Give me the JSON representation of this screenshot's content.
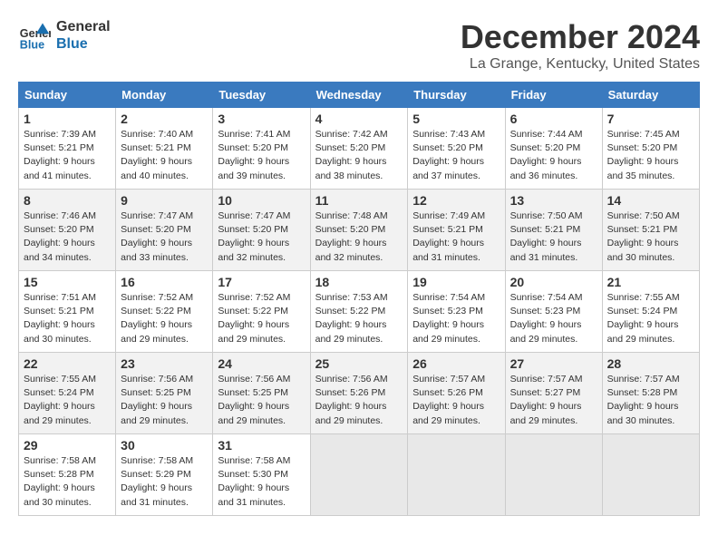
{
  "header": {
    "logo_line1": "General",
    "logo_line2": "Blue",
    "month": "December 2024",
    "location": "La Grange, Kentucky, United States"
  },
  "weekdays": [
    "Sunday",
    "Monday",
    "Tuesday",
    "Wednesday",
    "Thursday",
    "Friday",
    "Saturday"
  ],
  "weeks": [
    [
      {
        "day": "1",
        "sunrise": "Sunrise: 7:39 AM",
        "sunset": "Sunset: 5:21 PM",
        "daylight": "Daylight: 9 hours and 41 minutes."
      },
      {
        "day": "2",
        "sunrise": "Sunrise: 7:40 AM",
        "sunset": "Sunset: 5:21 PM",
        "daylight": "Daylight: 9 hours and 40 minutes."
      },
      {
        "day": "3",
        "sunrise": "Sunrise: 7:41 AM",
        "sunset": "Sunset: 5:20 PM",
        "daylight": "Daylight: 9 hours and 39 minutes."
      },
      {
        "day": "4",
        "sunrise": "Sunrise: 7:42 AM",
        "sunset": "Sunset: 5:20 PM",
        "daylight": "Daylight: 9 hours and 38 minutes."
      },
      {
        "day": "5",
        "sunrise": "Sunrise: 7:43 AM",
        "sunset": "Sunset: 5:20 PM",
        "daylight": "Daylight: 9 hours and 37 minutes."
      },
      {
        "day": "6",
        "sunrise": "Sunrise: 7:44 AM",
        "sunset": "Sunset: 5:20 PM",
        "daylight": "Daylight: 9 hours and 36 minutes."
      },
      {
        "day": "7",
        "sunrise": "Sunrise: 7:45 AM",
        "sunset": "Sunset: 5:20 PM",
        "daylight": "Daylight: 9 hours and 35 minutes."
      }
    ],
    [
      {
        "day": "8",
        "sunrise": "Sunrise: 7:46 AM",
        "sunset": "Sunset: 5:20 PM",
        "daylight": "Daylight: 9 hours and 34 minutes."
      },
      {
        "day": "9",
        "sunrise": "Sunrise: 7:47 AM",
        "sunset": "Sunset: 5:20 PM",
        "daylight": "Daylight: 9 hours and 33 minutes."
      },
      {
        "day": "10",
        "sunrise": "Sunrise: 7:47 AM",
        "sunset": "Sunset: 5:20 PM",
        "daylight": "Daylight: 9 hours and 32 minutes."
      },
      {
        "day": "11",
        "sunrise": "Sunrise: 7:48 AM",
        "sunset": "Sunset: 5:20 PM",
        "daylight": "Daylight: 9 hours and 32 minutes."
      },
      {
        "day": "12",
        "sunrise": "Sunrise: 7:49 AM",
        "sunset": "Sunset: 5:21 PM",
        "daylight": "Daylight: 9 hours and 31 minutes."
      },
      {
        "day": "13",
        "sunrise": "Sunrise: 7:50 AM",
        "sunset": "Sunset: 5:21 PM",
        "daylight": "Daylight: 9 hours and 31 minutes."
      },
      {
        "day": "14",
        "sunrise": "Sunrise: 7:50 AM",
        "sunset": "Sunset: 5:21 PM",
        "daylight": "Daylight: 9 hours and 30 minutes."
      }
    ],
    [
      {
        "day": "15",
        "sunrise": "Sunrise: 7:51 AM",
        "sunset": "Sunset: 5:21 PM",
        "daylight": "Daylight: 9 hours and 30 minutes."
      },
      {
        "day": "16",
        "sunrise": "Sunrise: 7:52 AM",
        "sunset": "Sunset: 5:22 PM",
        "daylight": "Daylight: 9 hours and 29 minutes."
      },
      {
        "day": "17",
        "sunrise": "Sunrise: 7:52 AM",
        "sunset": "Sunset: 5:22 PM",
        "daylight": "Daylight: 9 hours and 29 minutes."
      },
      {
        "day": "18",
        "sunrise": "Sunrise: 7:53 AM",
        "sunset": "Sunset: 5:22 PM",
        "daylight": "Daylight: 9 hours and 29 minutes."
      },
      {
        "day": "19",
        "sunrise": "Sunrise: 7:54 AM",
        "sunset": "Sunset: 5:23 PM",
        "daylight": "Daylight: 9 hours and 29 minutes."
      },
      {
        "day": "20",
        "sunrise": "Sunrise: 7:54 AM",
        "sunset": "Sunset: 5:23 PM",
        "daylight": "Daylight: 9 hours and 29 minutes."
      },
      {
        "day": "21",
        "sunrise": "Sunrise: 7:55 AM",
        "sunset": "Sunset: 5:24 PM",
        "daylight": "Daylight: 9 hours and 29 minutes."
      }
    ],
    [
      {
        "day": "22",
        "sunrise": "Sunrise: 7:55 AM",
        "sunset": "Sunset: 5:24 PM",
        "daylight": "Daylight: 9 hours and 29 minutes."
      },
      {
        "day": "23",
        "sunrise": "Sunrise: 7:56 AM",
        "sunset": "Sunset: 5:25 PM",
        "daylight": "Daylight: 9 hours and 29 minutes."
      },
      {
        "day": "24",
        "sunrise": "Sunrise: 7:56 AM",
        "sunset": "Sunset: 5:25 PM",
        "daylight": "Daylight: 9 hours and 29 minutes."
      },
      {
        "day": "25",
        "sunrise": "Sunrise: 7:56 AM",
        "sunset": "Sunset: 5:26 PM",
        "daylight": "Daylight: 9 hours and 29 minutes."
      },
      {
        "day": "26",
        "sunrise": "Sunrise: 7:57 AM",
        "sunset": "Sunset: 5:26 PM",
        "daylight": "Daylight: 9 hours and 29 minutes."
      },
      {
        "day": "27",
        "sunrise": "Sunrise: 7:57 AM",
        "sunset": "Sunset: 5:27 PM",
        "daylight": "Daylight: 9 hours and 29 minutes."
      },
      {
        "day": "28",
        "sunrise": "Sunrise: 7:57 AM",
        "sunset": "Sunset: 5:28 PM",
        "daylight": "Daylight: 9 hours and 30 minutes."
      }
    ],
    [
      {
        "day": "29",
        "sunrise": "Sunrise: 7:58 AM",
        "sunset": "Sunset: 5:28 PM",
        "daylight": "Daylight: 9 hours and 30 minutes."
      },
      {
        "day": "30",
        "sunrise": "Sunrise: 7:58 AM",
        "sunset": "Sunset: 5:29 PM",
        "daylight": "Daylight: 9 hours and 31 minutes."
      },
      {
        "day": "31",
        "sunrise": "Sunrise: 7:58 AM",
        "sunset": "Sunset: 5:30 PM",
        "daylight": "Daylight: 9 hours and 31 minutes."
      },
      null,
      null,
      null,
      null
    ]
  ]
}
